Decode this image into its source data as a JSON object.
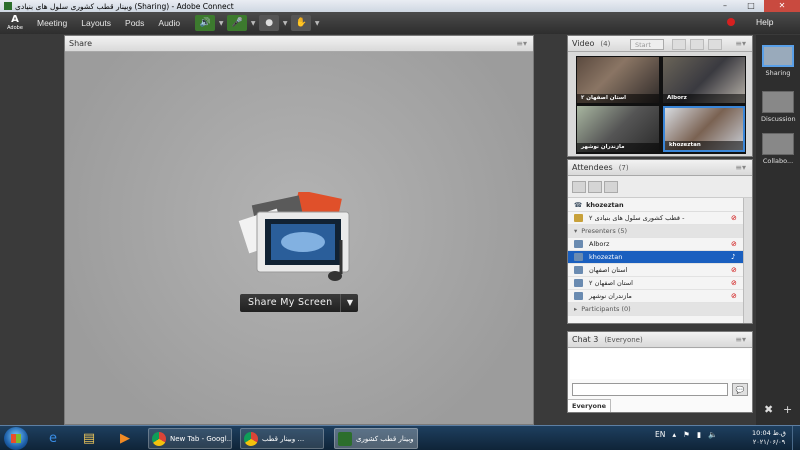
{
  "window": {
    "title": "وبینار قطب کشوری سلول های بنیادی (Sharing) - Adobe Connect"
  },
  "menubar": {
    "logo_text": "Adobe",
    "items": [
      "Meeting",
      "Layouts",
      "Pods",
      "Audio"
    ],
    "help": "Help"
  },
  "share_pod": {
    "title": "Share",
    "button_label": "Share My Screen"
  },
  "video_pod": {
    "title": "Video",
    "count": "(4)",
    "start_label": "Start",
    "tiles": [
      {
        "name": "استان اصفهان ۲"
      },
      {
        "name": "Alborz"
      },
      {
        "name": "مازندران نوشهر"
      },
      {
        "name": "khozeztan"
      }
    ]
  },
  "attendees_pod": {
    "title": "Attendees",
    "count": "(7)",
    "current_user": "khozeztan",
    "host": "قطب کشوری سلول های بنیادی ۲ -",
    "presenters_group": "Presenters (5)",
    "presenters": [
      "Alborz",
      "khozeztan",
      "استان اصفهان",
      "استان اصفهان ۲",
      "مازندران نوشهر"
    ],
    "participants_group": "Participants (0)"
  },
  "chat_pod": {
    "title": "Chat 3",
    "scope": "(Everyone)",
    "tab": "Everyone"
  },
  "layouts": {
    "items": [
      "Sharing",
      "Discussion",
      "Collabo..."
    ]
  },
  "taskbar": {
    "tasks": [
      "New Tab - Googl...",
      "وبینار قطب ...",
      "وبینار قطب کشوری"
    ],
    "lang": "EN",
    "time": "10:04 ق.ظ",
    "date": "۲۰۲۱/۰۶/۰۹"
  },
  "colors": {
    "accent": "#1a5fbf",
    "record": "#d62020",
    "mic_on": "#3c7a2e"
  }
}
